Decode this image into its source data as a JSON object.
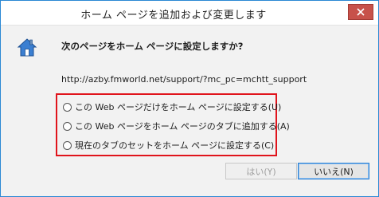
{
  "window": {
    "title": "ホーム ページを追加および変更します"
  },
  "dialog": {
    "question": "次のページをホーム ページに設定しますか?",
    "url": "http://azby.fmworld.net/support/?mc_pc=mchtt_support",
    "options": [
      {
        "label": "この Web ページだけをホーム ページに設定する(U)"
      },
      {
        "label": "この Web ページをホーム ページのタブに追加する(A)"
      },
      {
        "label": "現在のタブのセットをホーム ページに設定する(C)"
      }
    ]
  },
  "buttons": {
    "yes_label": "はい(Y)",
    "no_label": "いいえ(N)"
  },
  "colors": {
    "highlight_border": "#e0141c",
    "close_button": "#c7514a",
    "window_border": "#2a88d4"
  },
  "icons": {
    "dialog": "home-icon",
    "close": "close-icon"
  }
}
